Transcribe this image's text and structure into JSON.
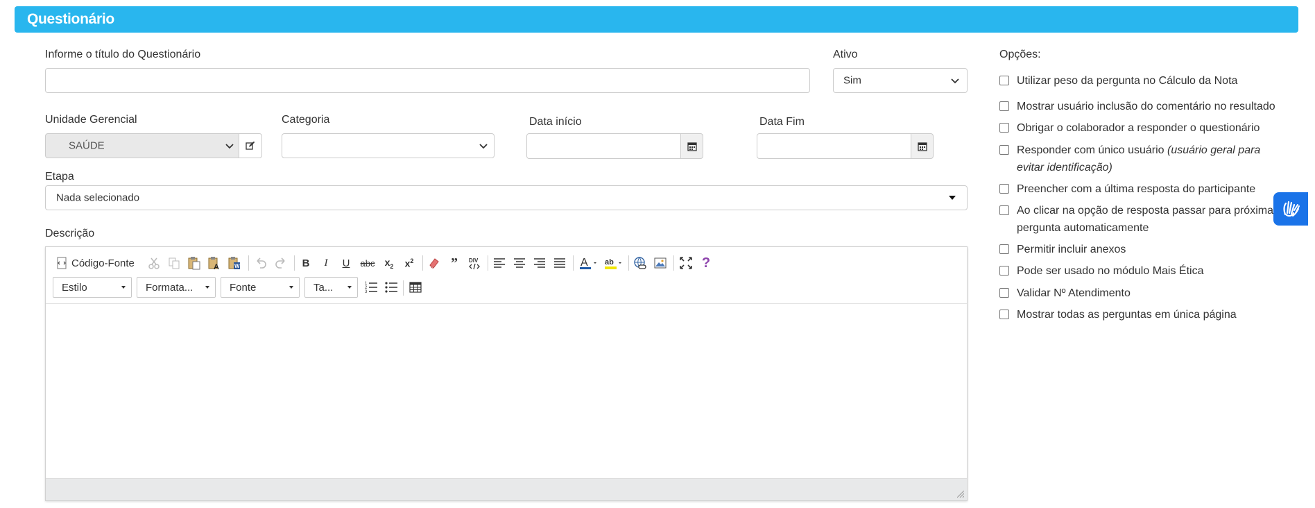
{
  "header": {
    "title": "Questionário"
  },
  "form": {
    "title_label": "Informe o título do Questionário",
    "title_value": "",
    "ativo_label": "Ativo",
    "ativo_value": "Sim",
    "unidade_label": "Unidade Gerencial",
    "unidade_value": "SAÚDE",
    "categoria_label": "Categoria",
    "categoria_value": "",
    "data_inicio_label": "Data início",
    "data_fim_label": "Data Fim",
    "etapa_label": "Etapa",
    "etapa_value": "Nada selecionado",
    "descricao_label": "Descrição"
  },
  "editor": {
    "source_label": "Código-Fonte",
    "combos": {
      "estilo": "Estilo",
      "formatacao": "Formata...",
      "fonte": "Fonte",
      "tamanho": "Ta..."
    },
    "icons": [
      "source-code-icon",
      "cut-icon",
      "copy-icon",
      "paste-icon",
      "paste-text-icon",
      "paste-word-icon",
      "undo-icon",
      "redo-icon",
      "bold-icon",
      "italic-icon",
      "underline-icon",
      "strikethrough-icon",
      "subscript-icon",
      "superscript-icon",
      "remove-format-icon",
      "blockquote-icon",
      "div-icon",
      "align-left-icon",
      "align-center-icon",
      "align-right-icon",
      "justify-icon",
      "text-color-icon",
      "bg-color-icon",
      "link-icon",
      "image-icon",
      "maximize-icon",
      "help-icon",
      "numbered-list-icon",
      "bulleted-list-icon",
      "table-icon"
    ]
  },
  "options": {
    "title": "Opções:",
    "items": [
      {
        "label": "Utilizar peso da pergunta no Cálculo da Nota"
      },
      {
        "label": "Mostrar usuário inclusão do comentário no resultado"
      },
      {
        "label": "Obrigar o colaborador a responder o questionário"
      },
      {
        "label": "Responder com único usuário ",
        "note": "(usuário geral para evitar identificação)"
      },
      {
        "label": "Preencher com a última resposta do participante"
      },
      {
        "label": "Ao clicar na opção de resposta passar para próxima pergunta automaticamente"
      },
      {
        "label": "Permitir incluir anexos"
      },
      {
        "label": "Pode ser usado no módulo Mais Ética"
      },
      {
        "label": "Validar Nº Atendimento"
      },
      {
        "label": "Mostrar todas as perguntas em única página"
      }
    ]
  },
  "colors": {
    "header_bg": "#29b6ee",
    "accent_blue": "#1a73e8"
  }
}
